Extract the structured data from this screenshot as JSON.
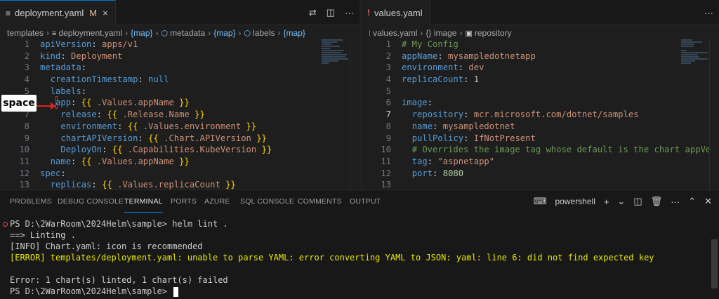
{
  "left_editor": {
    "tab": {
      "icon": "lines-icon",
      "label": "deployment.yaml",
      "modified": "M",
      "close": "×"
    },
    "breadcrumbs": [
      "templates",
      "deployment.yaml",
      "{map}",
      "metadata",
      "{map}",
      "labels",
      "{map}"
    ],
    "lines": [
      {
        "n": "1",
        "t": "apiVersion: apps/v1"
      },
      {
        "n": "2",
        "t": "kind: Deployment"
      },
      {
        "n": "3",
        "t": "metadata:"
      },
      {
        "n": "4",
        "t": "  creationTimestamp: null"
      },
      {
        "n": "5",
        "t": "  labels:"
      },
      {
        "n": "6",
        "t": "   app: {{ .Values.appName }}"
      },
      {
        "n": "7",
        "t": "    release: {{ .Release.Name }}"
      },
      {
        "n": "8",
        "t": "    environment: {{ .Values.environment }}"
      },
      {
        "n": "9",
        "t": "    chartAPIVersion: {{ .Chart.APIVersion }}"
      },
      {
        "n": "10",
        "t": "    DeployOn: {{ .Capabilities.KubeVersion }}"
      },
      {
        "n": "11",
        "t": "  name: {{ .Values.appName }}"
      },
      {
        "n": "12",
        "t": "spec:"
      },
      {
        "n": "13",
        "t": "  replicas: {{ .Values.replicaCount }}"
      }
    ]
  },
  "right_editor": {
    "tab": {
      "icon": "!",
      "label": "values.yaml"
    },
    "breadcrumbs": [
      "values.yaml",
      "{} image",
      "repository"
    ],
    "lines": [
      {
        "n": "1",
        "t": "# My Config"
      },
      {
        "n": "2",
        "t": "appName: mysampledotnetapp"
      },
      {
        "n": "3",
        "t": "environment: dev"
      },
      {
        "n": "4",
        "t": "replicaCount: 1"
      },
      {
        "n": "5",
        "t": ""
      },
      {
        "n": "6",
        "t": "image:"
      },
      {
        "n": "7",
        "t": "  repository: mcr.microsoft.com/dotnet/samples"
      },
      {
        "n": "8",
        "t": "  name: mysampledotnet"
      },
      {
        "n": "9",
        "t": "  pullPolicy: IfNotPresent"
      },
      {
        "n": "10",
        "t": "  # Overrides the image tag whose default is the chart appVe"
      },
      {
        "n": "11",
        "t": "  tag: \"aspnetapp\""
      },
      {
        "n": "12",
        "t": "  port: 8080"
      },
      {
        "n": "13",
        "t": ""
      }
    ]
  },
  "annotation": {
    "label": "space"
  },
  "panel": {
    "tabs": [
      "PROBLEMS",
      "DEBUG CONSOLE",
      "TERMINAL",
      "PORTS",
      "AZURE",
      "SQL CONSOLE",
      "COMMENTS",
      "OUTPUT"
    ],
    "active_tab": "TERMINAL",
    "shell": "powershell",
    "terminal_lines": [
      {
        "t": "PS D:\\2WarRoom\\2024Helm\\sample> helm lint .",
        "kind": "prompt-error"
      },
      {
        "t": "==> Linting .",
        "kind": "normal"
      },
      {
        "t": "[INFO] Chart.yaml: icon is recommended",
        "kind": "normal"
      },
      {
        "t": "[ERROR] templates/deployment.yaml: unable to parse YAML: error converting YAML to JSON: yaml: line 6: did not find expected key",
        "kind": "error"
      },
      {
        "t": "",
        "kind": "normal"
      },
      {
        "t": "Error: 1 chart(s) linted, 1 chart(s) failed",
        "kind": "normal"
      },
      {
        "t": "PS D:\\2WarRoom\\2024Helm\\sample> ",
        "kind": "prompt"
      }
    ]
  },
  "colors": {
    "accent": "#0078d4",
    "key": "#569cd6",
    "string": "#ce9178",
    "error_text": "#e5e510",
    "error_dot": "#f14c4c"
  }
}
